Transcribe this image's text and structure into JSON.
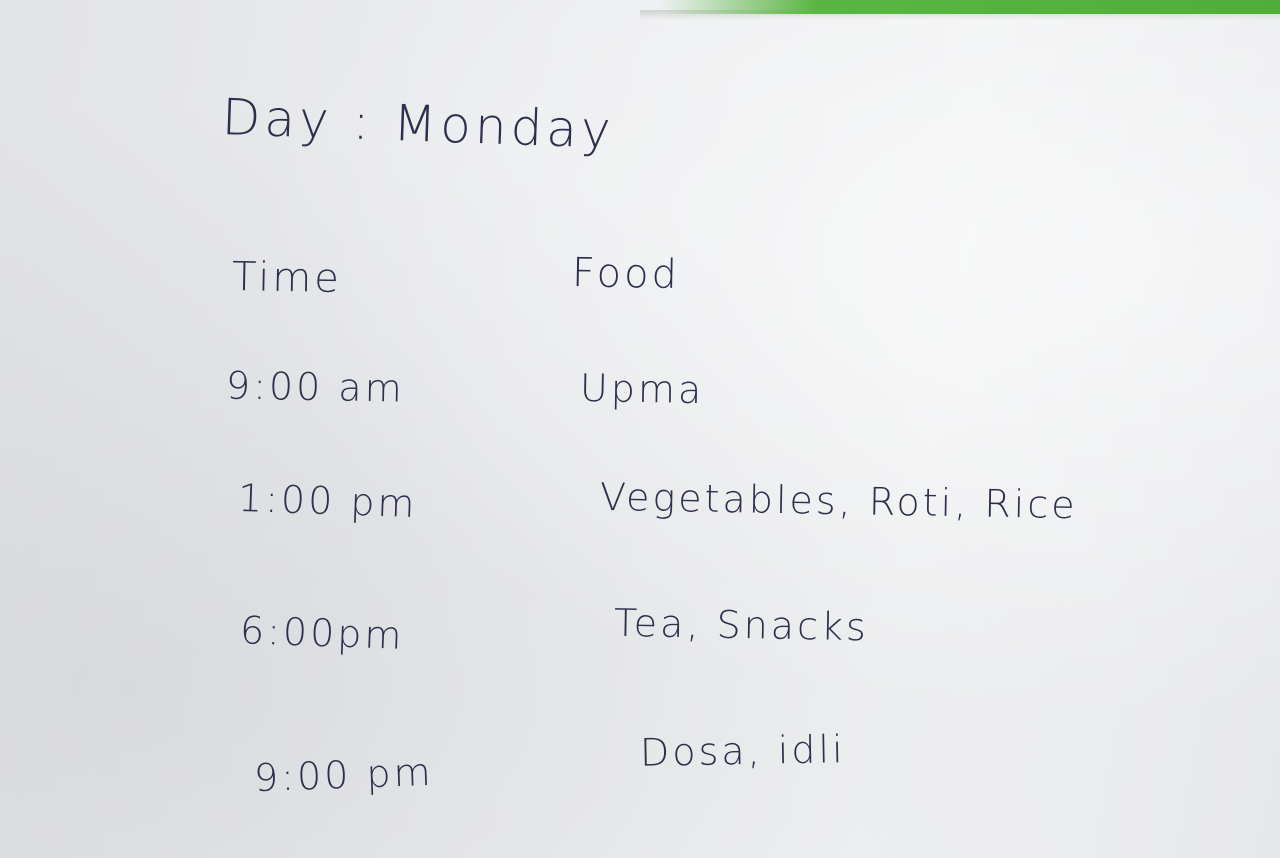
{
  "note": {
    "title": "Day : Monday",
    "headers": {
      "time": "Time",
      "food": "Food"
    },
    "rows": [
      {
        "time": "9:00 am",
        "food": "Upma"
      },
      {
        "time": "1:00 pm",
        "food": "Vegetables, Roti, Rice"
      },
      {
        "time": "6:00pm",
        "food": "Tea, Snacks"
      },
      {
        "time": "9:00 pm",
        "food": "Dosa, idli"
      }
    ]
  },
  "colors": {
    "ink": "#2d2f4c",
    "paper": "#eceef0",
    "folder_edge": "#4fae3a"
  }
}
